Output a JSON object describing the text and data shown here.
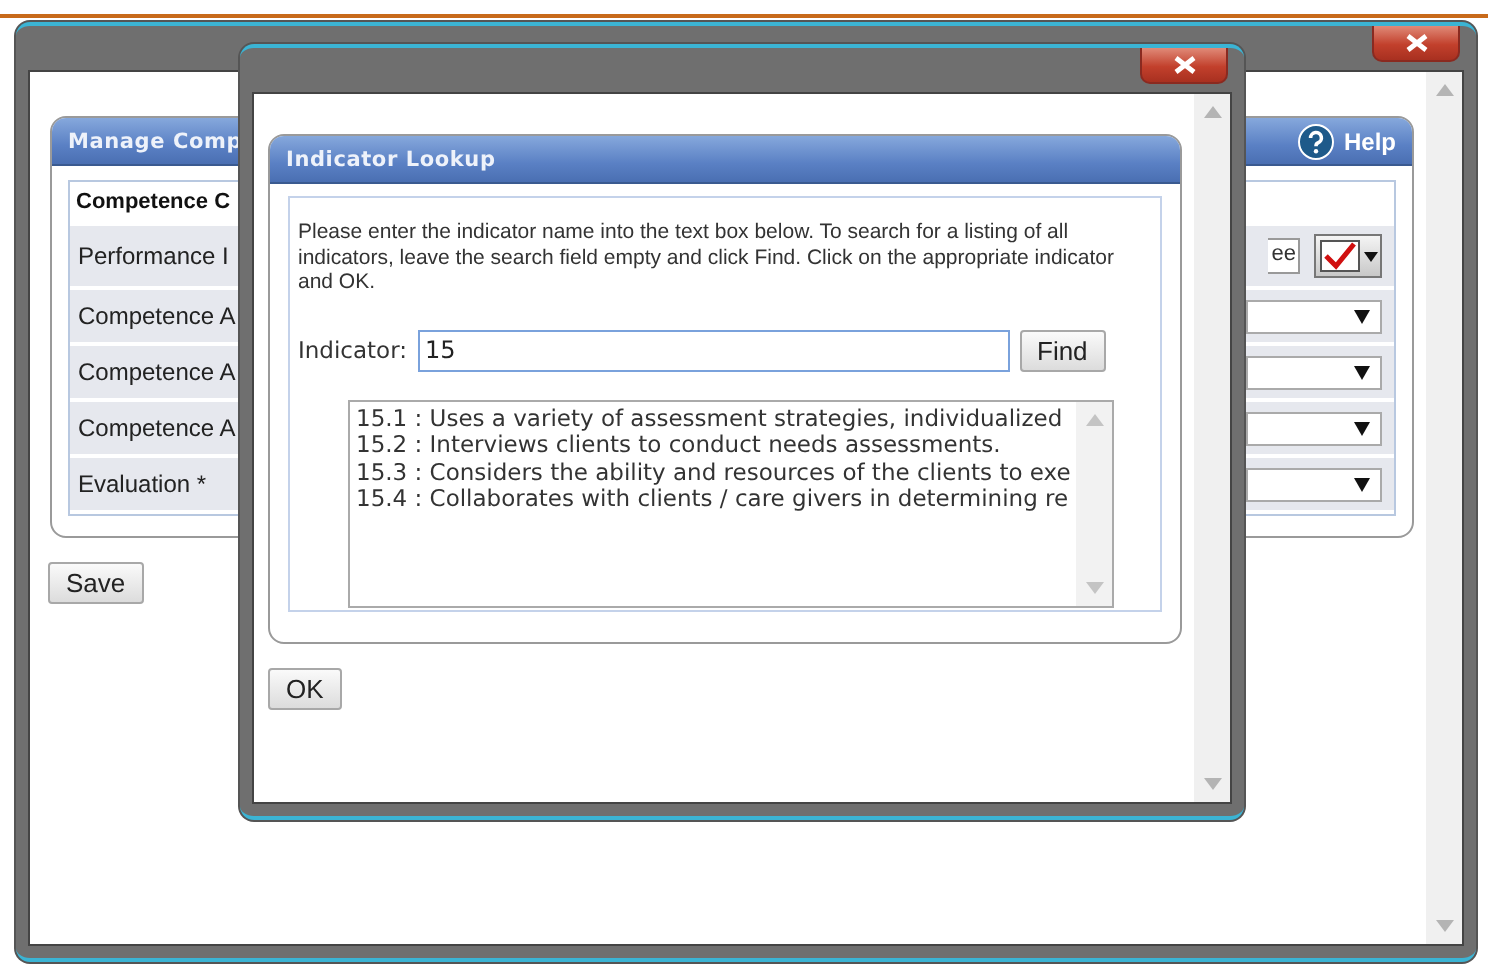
{
  "background_form": {
    "title": "Manage Comp",
    "help": "Help",
    "header": "Competence C",
    "rows": [
      {
        "label": "Performance I",
        "kind": "field",
        "value": "ee"
      },
      {
        "label": "Competence A",
        "kind": "select"
      },
      {
        "label": "Competence A",
        "kind": "select"
      },
      {
        "label": "Competence A",
        "kind": "select"
      },
      {
        "label": "Evaluation *",
        "kind": "select"
      }
    ],
    "save": "Save"
  },
  "indicator_lookup": {
    "title": "Indicator Lookup",
    "instructions": "Please enter the indicator name into the text box below. To search for a listing of all indicators, leave the search field empty and click Find. Click on the appropriate indicator and OK.",
    "field_label": "Indicator:",
    "value": "15",
    "find": "Find",
    "results": [
      {
        "text": "15.1 : Uses a variety of assessment strategies, individualized",
        "selected": false
      },
      {
        "text": "15.2 : Interviews clients to conduct needs assessments.",
        "selected": false
      },
      {
        "text": "15.3 : Considers the ability and resources of the clients to exe",
        "selected": false
      },
      {
        "text": "15.4 : Collaborates with clients / care givers in determining re",
        "selected": false
      }
    ],
    "ok": "OK"
  }
}
